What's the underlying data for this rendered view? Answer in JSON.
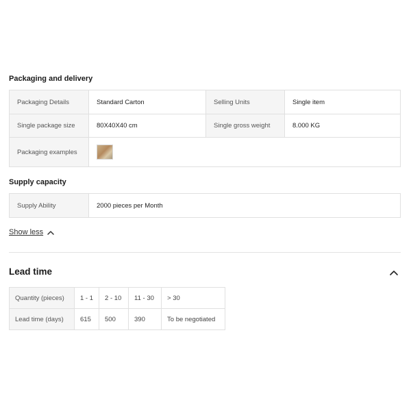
{
  "packaging": {
    "title": "Packaging and delivery",
    "rows": [
      [
        "Packaging Details",
        "Standard Carton",
        "Selling Units",
        "Single item"
      ],
      [
        "Single package size",
        "80X40X40 cm",
        "Single gross weight",
        "8.000 KG"
      ]
    ],
    "examples_label": "Packaging examples",
    "examples_image_icon": "packaging-photo-thumbnail"
  },
  "supply": {
    "title": "Supply capacity",
    "label": "Supply Ability",
    "value": "2000 pieces per Month"
  },
  "show_less": {
    "label": "Show less",
    "icon": "chevron-up-icon"
  },
  "lead_time": {
    "title": "Lead time",
    "collapse_icon": "chevron-up-icon",
    "quantity_label": "Quantity (pieces)",
    "lead_label": "Lead time (days)",
    "quantities": [
      "1 - 1",
      "2 - 10",
      "11 - 30",
      "> 30"
    ],
    "days": [
      "615",
      "500",
      "390",
      "To be negotiated"
    ]
  }
}
